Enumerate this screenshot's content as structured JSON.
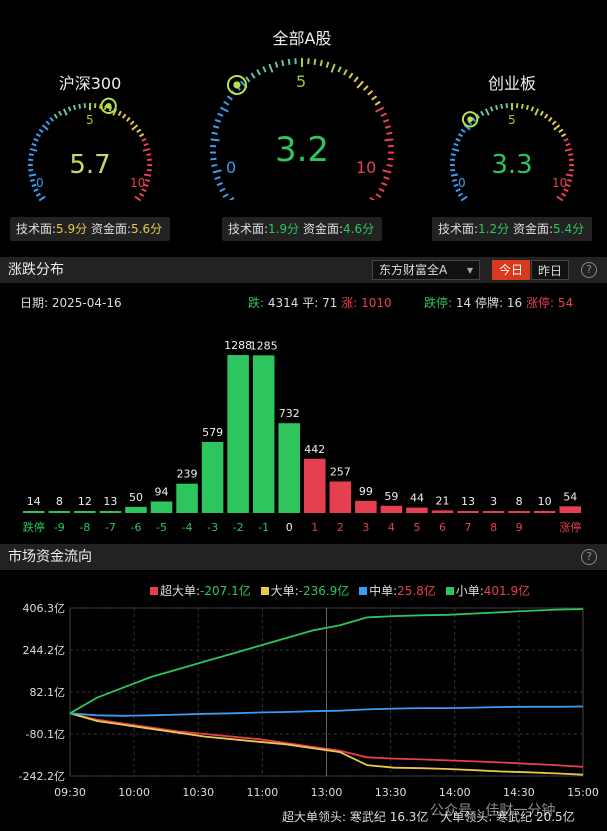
{
  "gauges": [
    {
      "title": "沪深300",
      "value": "5.7",
      "min": "0",
      "mid": "5",
      "max": "10",
      "value_num": 5.7,
      "value_color": "#c8d66a",
      "tech_label": "技术面:",
      "tech_val": "5.9分",
      "fund_label": "资金面:",
      "fund_val": "5.6分",
      "tech_color": "#e6c84a",
      "fund_color": "#e6c84a"
    },
    {
      "title": "全部A股",
      "value": "3.2",
      "min": "0",
      "mid": "5",
      "max": "10",
      "value_num": 3.2,
      "value_color": "#2ec45e",
      "tech_label": "技术面:",
      "tech_val": "1.9分",
      "fund_label": "资金面:",
      "fund_val": "4.6分",
      "tech_color": "#2ec45e",
      "fund_color": "#2ec45e"
    },
    {
      "title": "创业板",
      "value": "3.3",
      "min": "0",
      "mid": "5",
      "max": "10",
      "value_num": 3.3,
      "value_color": "#2ec45e",
      "tech_label": "技术面:",
      "tech_val": "1.2分",
      "fund_label": "资金面:",
      "fund_val": "5.4分",
      "tech_color": "#2ec45e",
      "fund_color": "#2ec45e"
    }
  ],
  "dist": {
    "title": "涨跌分布",
    "source": "东方财富全A",
    "today": "今日",
    "yesterday": "昨日",
    "date_label": "日期:",
    "date": "2025-04-16",
    "down_label": "跌:",
    "down": "4314",
    "flat_label": "平:",
    "flat": "71",
    "up_label": "涨:",
    "up": "1010",
    "limitdown_label": "跌停:",
    "limitdown": "14",
    "halt_label": "停牌:",
    "halt": "16",
    "limitup_label": "涨停:",
    "limitup": "54"
  },
  "flow": {
    "title": "市场资金流向",
    "legend": [
      {
        "name": "超大单:",
        "value": "-207.1亿",
        "color": "#e5404f",
        "value_color": "#2ec45e"
      },
      {
        "name": "大单:",
        "value": "-236.9亿",
        "color": "#e6c84a",
        "value_color": "#2ec45e"
      },
      {
        "name": "中单:",
        "value": "25.8亿",
        "color": "#3b9bf0",
        "value_color": "#e5404f"
      },
      {
        "name": "小单:",
        "value": "401.9亿",
        "color": "#2ec45e",
        "value_color": "#e5404f"
      }
    ],
    "footer_label1": "超大单领头:",
    "footer_val1": "寒武纪 16.3亿",
    "footer_label2": "大单领头:",
    "footer_val2": "寒武纪 20.5亿",
    "watermark": "公众号 · 佳财一分钟"
  },
  "chart_data": [
    {
      "type": "bar",
      "title": "涨跌分布",
      "categories": [
        "跌停",
        "-9",
        "-8",
        "-7",
        "-6",
        "-5",
        "-4",
        "-3",
        "-2",
        "-1",
        "0",
        "1",
        "2",
        "3",
        "4",
        "5",
        "6",
        "7",
        "8",
        "9",
        "涨停"
      ],
      "values": [
        14,
        8,
        12,
        13,
        50,
        94,
        239,
        579,
        1288,
        1285,
        732,
        442,
        257,
        99,
        59,
        44,
        21,
        13,
        3,
        8,
        10,
        54
      ],
      "value_labels": [
        "14",
        "8",
        "12",
        "13",
        "50",
        "94",
        "239",
        "579",
        "1288",
        "1285",
        "732",
        "442",
        "257",
        "99",
        "59",
        "44",
        "21",
        "13",
        "3",
        "8",
        "10",
        "54"
      ],
      "colors": [
        "green",
        "green",
        "green",
        "green",
        "green",
        "green",
        "green",
        "green",
        "green",
        "green",
        "green",
        "red",
        "red",
        "red",
        "red",
        "red",
        "red",
        "red",
        "red",
        "red",
        "red",
        "red"
      ]
    },
    {
      "type": "line",
      "title": "市场资金流向",
      "x_ticks": [
        "09:30",
        "10:00",
        "10:30",
        "11:00",
        "13:00",
        "13:30",
        "14:00",
        "14:30",
        "15:00"
      ],
      "y_ticks": [
        "406.3亿",
        "244.2亿",
        "82.1亿",
        "-80.1亿",
        "-242.2亿"
      ],
      "ylim": [
        -242.2,
        406.3
      ],
      "series": [
        {
          "name": "超大单",
          "color": "#e5404f",
          "values": [
            0,
            -25,
            -40,
            -55,
            -70,
            -80,
            -90,
            -100,
            -115,
            -130,
            -145,
            -170,
            -175,
            -178,
            -182,
            -186,
            -190,
            -195,
            -200,
            -207
          ]
        },
        {
          "name": "大单",
          "color": "#e6c84a",
          "values": [
            0,
            -30,
            -45,
            -60,
            -75,
            -90,
            -100,
            -110,
            -120,
            -135,
            -150,
            -200,
            -210,
            -212,
            -215,
            -220,
            -225,
            -228,
            -232,
            -237
          ]
        },
        {
          "name": "中单",
          "color": "#3b9bf0",
          "values": [
            0,
            -8,
            -10,
            -8,
            -5,
            -2,
            0,
            3,
            5,
            8,
            10,
            15,
            18,
            20,
            20,
            22,
            24,
            25,
            25,
            26
          ]
        },
        {
          "name": "小单",
          "color": "#2ec45e",
          "values": [
            0,
            60,
            100,
            140,
            170,
            200,
            230,
            260,
            290,
            320,
            340,
            370,
            375,
            378,
            380,
            385,
            390,
            395,
            400,
            402
          ]
        }
      ]
    }
  ]
}
